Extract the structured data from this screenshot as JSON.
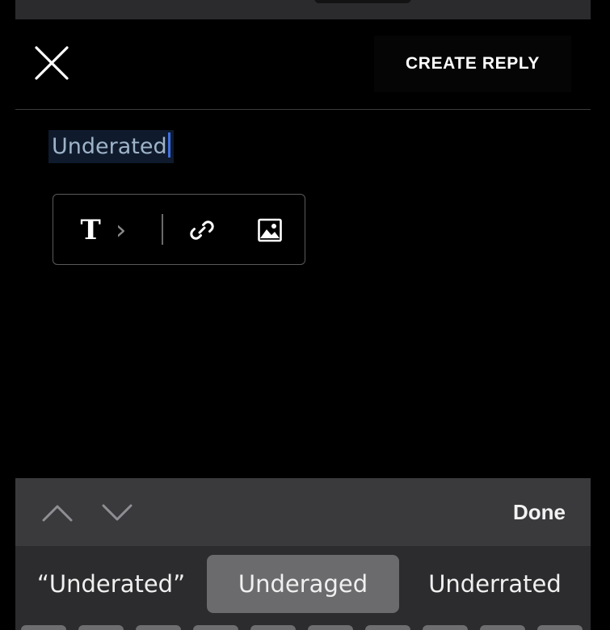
{
  "header": {
    "create_reply_label": "CREATE REPLY"
  },
  "editor": {
    "text": "Underated"
  },
  "toolbar": {
    "text_format_glyph": "T",
    "expand_glyph": "›",
    "icons": [
      "text-format-icon",
      "chevron-right-icon",
      "link-icon",
      "image-icon"
    ]
  },
  "keyboard_bar": {
    "done_label": "Done"
  },
  "suggestions": {
    "items": [
      "“Underated”",
      "Underaged",
      "Underrated"
    ],
    "selected_index": 1
  },
  "colors": {
    "background": "#000000",
    "keyboard_bar": "#3a3a3c",
    "suggestion_strip": "#2c2c2e",
    "selected_suggestion": "#6b6b6e",
    "text_selection": "#0f1a2d",
    "caret": "#3f6fe0"
  }
}
